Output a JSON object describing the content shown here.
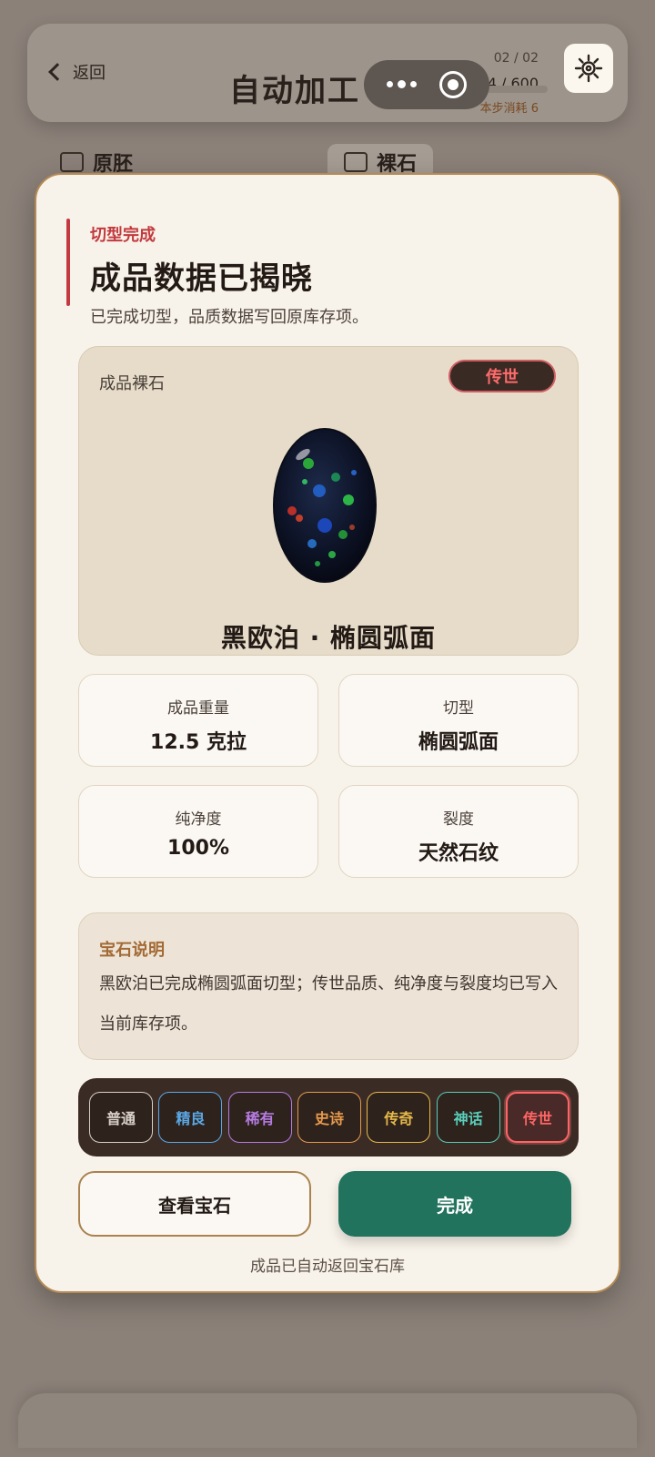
{
  "header": {
    "back_label": "返回",
    "title": "自动加工",
    "step_counter": "02 / 02",
    "progress_text": "214 / 600",
    "progress_fraction": 0.357,
    "step_cost": "本步消耗 6"
  },
  "bg_tabs": [
    {
      "label": "原胚"
    },
    {
      "label": "裸石"
    }
  ],
  "modal": {
    "eyebrow": "切型完成",
    "title": "成品数据已揭晓",
    "subtitle": "已完成切型，品质数据写回原库存项。",
    "gem_card": {
      "label": "成品裸石",
      "tier_badge": "传世",
      "name": "黑欧泊 · 椭圆弧面"
    },
    "stats": [
      {
        "label": "成品重量",
        "value": "12.5 克拉"
      },
      {
        "label": "切型",
        "value": "椭圆弧面"
      },
      {
        "label": "纯净度",
        "value": "100%"
      },
      {
        "label": "裂度",
        "value": "天然石纹"
      }
    ],
    "description": {
      "title": "宝石说明",
      "text": "黑欧泊已完成椭圆弧面切型；传世品质、纯净度与裂度均已写入当前库存项。"
    },
    "tiers": [
      {
        "label": "普通",
        "color": "#d8d0c8"
      },
      {
        "label": "精良",
        "color": "#5aa8e6"
      },
      {
        "label": "稀有",
        "color": "#b57ce0"
      },
      {
        "label": "史诗",
        "color": "#e79a4c"
      },
      {
        "label": "传奇",
        "color": "#e6b94a"
      },
      {
        "label": "神话",
        "color": "#58cdb8"
      },
      {
        "label": "传世",
        "color": "#ff6565",
        "active": true
      }
    ],
    "view_button": "查看宝石",
    "done_button": "完成",
    "footer_note": "成品已自动返回宝石库"
  },
  "colors": {
    "accent_red": "#c23a3f",
    "primary_green": "#21735d",
    "gold_border": "#b58a55"
  }
}
